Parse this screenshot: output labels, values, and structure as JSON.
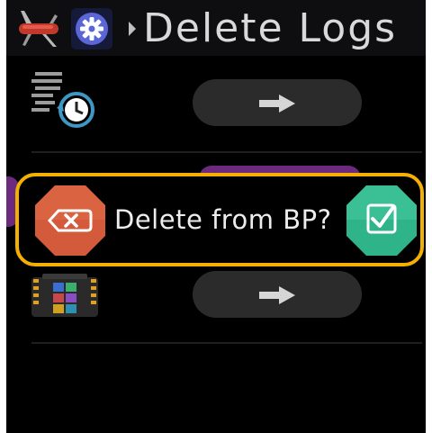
{
  "header": {
    "title": "Delete Logs",
    "tool_icon": "swiss-army-knife-icon",
    "settings_icon": "gear-icon",
    "breadcrumb_icon": "chevron-right-icon"
  },
  "rows": [
    {
      "icon": "log-history-icon",
      "action_icon": "arrow-right-icon"
    },
    {
      "icon": "color-grid-device-icon",
      "action_icon": "arrow-right-icon"
    }
  ],
  "dialog": {
    "prompt": "Delete from BP?",
    "cancel_icon": "backspace-x-icon",
    "confirm_icon": "checkbox-check-icon",
    "highlight_color": "#f3b000",
    "cancel_color": "#d35a3a",
    "confirm_color": "#2fb389"
  },
  "colors": {
    "background": "#000000",
    "pill": "#2b2b2b",
    "accent_purple": "#6b2a7d"
  }
}
